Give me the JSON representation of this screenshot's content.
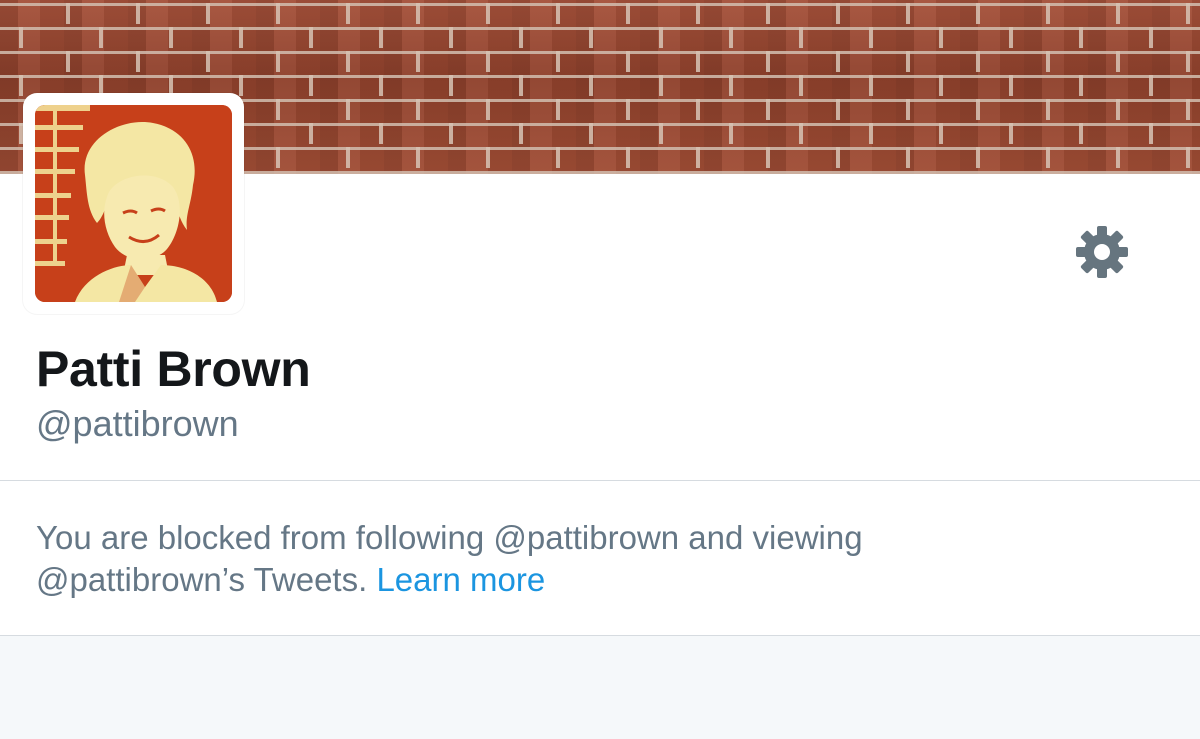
{
  "profile": {
    "name": "Patti Brown",
    "handle": "@pattibrown"
  },
  "icons": {
    "settings": "gear-icon",
    "avatar": "profile-photo",
    "banner": "brick-wall-banner"
  },
  "notice": {
    "line1": "You are blocked from following @pattibrown and viewing",
    "line2": "@pattibrown’s Tweets.",
    "link": "Learn more"
  },
  "colors": {
    "primary_text": "#14171a",
    "secondary_text": "#657786",
    "link": "#1b95e0",
    "avatar_bg": "#c7401a",
    "background": "#f5f8fa"
  }
}
